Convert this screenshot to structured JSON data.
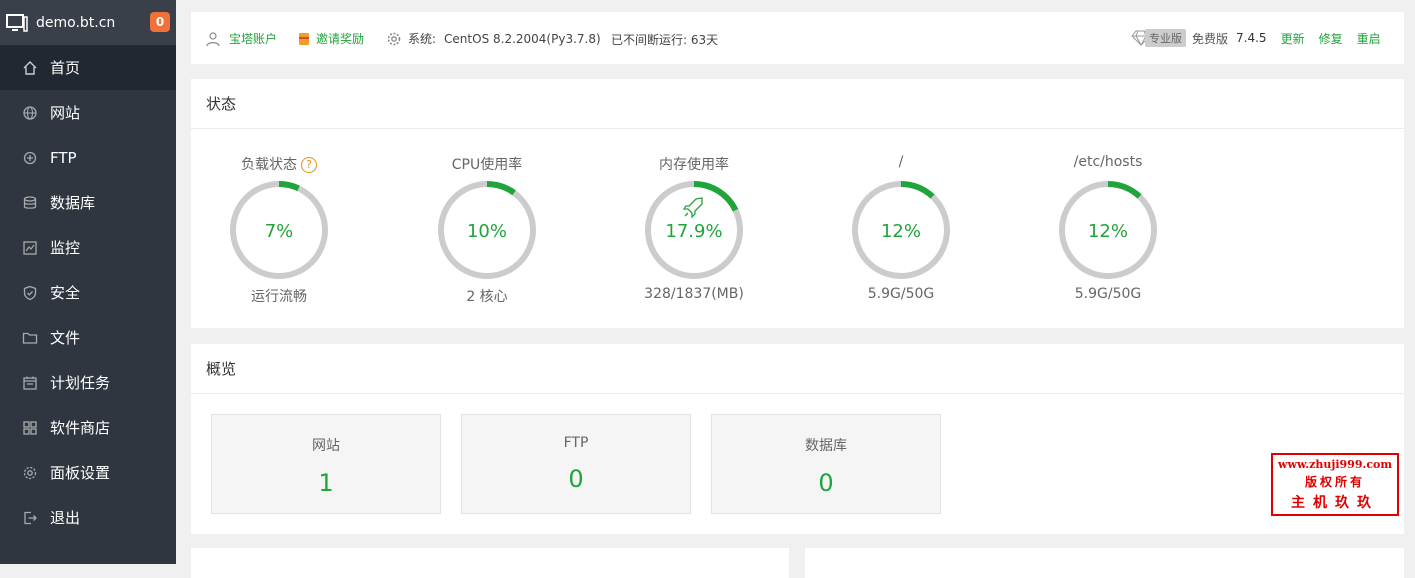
{
  "brand": {
    "host": "demo.bt.cn",
    "notifications": "0"
  },
  "sidebar": {
    "items": [
      {
        "label": "首页",
        "icon": "home-icon",
        "active": true
      },
      {
        "label": "网站",
        "icon": "globe-icon"
      },
      {
        "label": "FTP",
        "icon": "ftp-icon"
      },
      {
        "label": "数据库",
        "icon": "database-icon"
      },
      {
        "label": "监控",
        "icon": "monitor-icon"
      },
      {
        "label": "安全",
        "icon": "shield-icon"
      },
      {
        "label": "文件",
        "icon": "folder-icon"
      },
      {
        "label": "计划任务",
        "icon": "calendar-icon"
      },
      {
        "label": "软件商店",
        "icon": "grid-icon"
      },
      {
        "label": "面板设置",
        "icon": "gear-icon"
      },
      {
        "label": "退出",
        "icon": "logout-icon"
      }
    ]
  },
  "topbar": {
    "account": "宝塔账户",
    "invite": "邀请奖励",
    "system_label": "系统:",
    "system_value": "CentOS 8.2.2004(Py3.7.8)",
    "uptime": "已不间断运行: 63天",
    "pro_tag": "专业版",
    "edition": "免费版",
    "version": "7.4.5",
    "update": "更新",
    "repair": "修复",
    "restart": "重启"
  },
  "status": {
    "title": "状态",
    "gauges": [
      {
        "title": "负载状态",
        "percent": 7,
        "value": "7%",
        "sub": "运行流畅",
        "help": "?"
      },
      {
        "title": "CPU使用率",
        "percent": 10,
        "value": "10%",
        "sub": "2 核心"
      },
      {
        "title": "内存使用率",
        "percent": 17.9,
        "value": "17.9%",
        "sub": "328/1837(MB)"
      },
      {
        "title": "/",
        "percent": 12,
        "value": "12%",
        "sub": "5.9G/50G"
      },
      {
        "title": "/etc/hosts",
        "percent": 12,
        "value": "12%",
        "sub": "5.9G/50G"
      }
    ]
  },
  "overview": {
    "title": "概览",
    "cards": [
      {
        "label": "网站",
        "value": "1"
      },
      {
        "label": "FTP",
        "value": "0"
      },
      {
        "label": "数据库",
        "value": "0"
      }
    ]
  },
  "watermark": {
    "line1": "www.zhuji999.com",
    "line2": "版权所有",
    "line3": "主机玖玖"
  },
  "colors": {
    "accent": "#20a53a",
    "sidebar": "#2f3640",
    "sidebar_active": "#222831",
    "badge": "#f0713a",
    "ring_track": "#cccccc"
  }
}
